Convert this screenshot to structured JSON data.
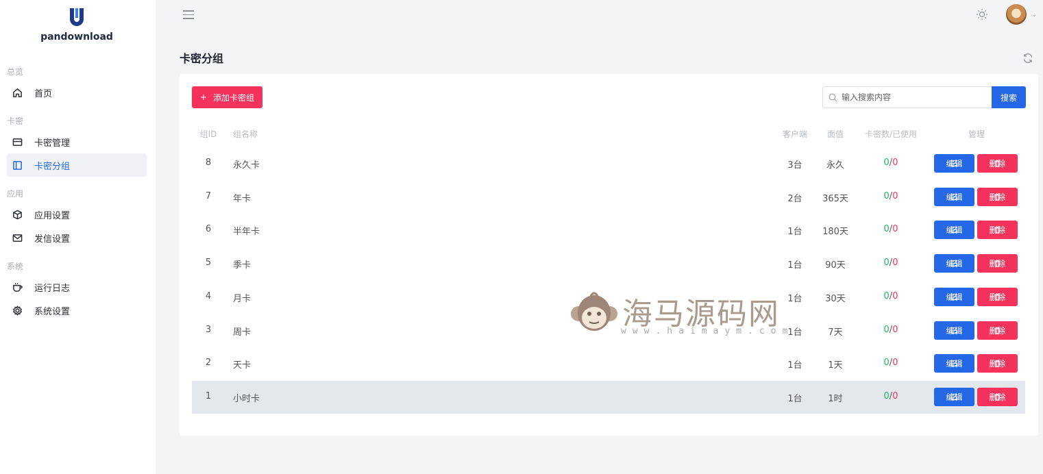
{
  "app": {
    "name": "pandownload"
  },
  "sidebar": {
    "sections": [
      {
        "title": "总览",
        "items": [
          {
            "label": "首页",
            "icon": "home-icon"
          }
        ]
      },
      {
        "title": "卡密",
        "items": [
          {
            "label": "卡密管理",
            "icon": "card-icon"
          },
          {
            "label": "卡密分组",
            "icon": "group-icon",
            "active": true
          }
        ]
      },
      {
        "title": "应用",
        "items": [
          {
            "label": "应用设置",
            "icon": "cube-icon"
          },
          {
            "label": "发信设置",
            "icon": "mail-icon"
          }
        ]
      },
      {
        "title": "系统",
        "items": [
          {
            "label": "运行日志",
            "icon": "cup-icon"
          },
          {
            "label": "系统设置",
            "icon": "gear-icon"
          }
        ]
      }
    ]
  },
  "page": {
    "title": "卡密分组"
  },
  "toolbar": {
    "add_label": "添加卡密组",
    "search_placeholder": "输入搜索内容",
    "search_label": "搜索"
  },
  "table": {
    "headers": {
      "id": "组ID",
      "name": "组名称",
      "client": "客户端",
      "value": "面值",
      "used": "卡密数/已使用",
      "ops": "管理"
    },
    "edit_label": "编辑",
    "delete_label": "删除",
    "rows": [
      {
        "id": "8",
        "name": "永久卡",
        "client": "3台",
        "value": "永久",
        "total": "0",
        "used": "0"
      },
      {
        "id": "7",
        "name": "年卡",
        "client": "2台",
        "value": "365天",
        "total": "0",
        "used": "0"
      },
      {
        "id": "6",
        "name": "半年卡",
        "client": "1台",
        "value": "180天",
        "total": "0",
        "used": "0"
      },
      {
        "id": "5",
        "name": "季卡",
        "client": "1台",
        "value": "90天",
        "total": "0",
        "used": "0"
      },
      {
        "id": "4",
        "name": "月卡",
        "client": "1台",
        "value": "30天",
        "total": "0",
        "used": "0"
      },
      {
        "id": "3",
        "name": "周卡",
        "client": "1台",
        "value": "7天",
        "total": "0",
        "used": "0"
      },
      {
        "id": "2",
        "name": "天卡",
        "client": "1台",
        "value": "1天",
        "total": "0",
        "used": "0"
      },
      {
        "id": "1",
        "name": "小时卡",
        "client": "1台",
        "value": "1时",
        "total": "0",
        "used": "0",
        "highlighted": true
      }
    ]
  },
  "watermark": {
    "text": "海马源码网",
    "url": "www.haimaym.com"
  },
  "colors": {
    "primary": "#2468e8",
    "danger": "#f5325c",
    "success": "#1cb85a"
  }
}
